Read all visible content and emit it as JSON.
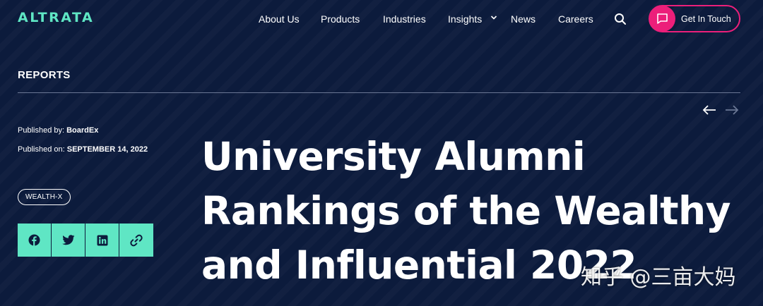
{
  "header": {
    "logo": "ALTRATA",
    "nav": [
      {
        "label": "About Us"
      },
      {
        "label": "Products"
      },
      {
        "label": "Industries"
      },
      {
        "label": "Insights"
      },
      {
        "label": "News"
      },
      {
        "label": "Careers"
      }
    ],
    "cta_label": "Get In Touch"
  },
  "article": {
    "section": "REPORTS",
    "published_by_label": "Published by:",
    "published_by": "BoardEx",
    "published_on_label": "Published on:",
    "published_on": "SEPTEMBER 14, 2022",
    "tag": "WEALTH-X",
    "title_lines": [
      "University Alumni",
      "Rankings of the Wealthy",
      "and Influential 2022"
    ]
  },
  "share": [
    "facebook-icon",
    "twitter-icon",
    "linkedin-icon",
    "link-icon"
  ],
  "colors": {
    "background": "#0c1b3c",
    "accent_mint": "#5fe6c4",
    "accent_pink": "#ec1f7a"
  },
  "watermark": "知乎 @三亩大妈"
}
